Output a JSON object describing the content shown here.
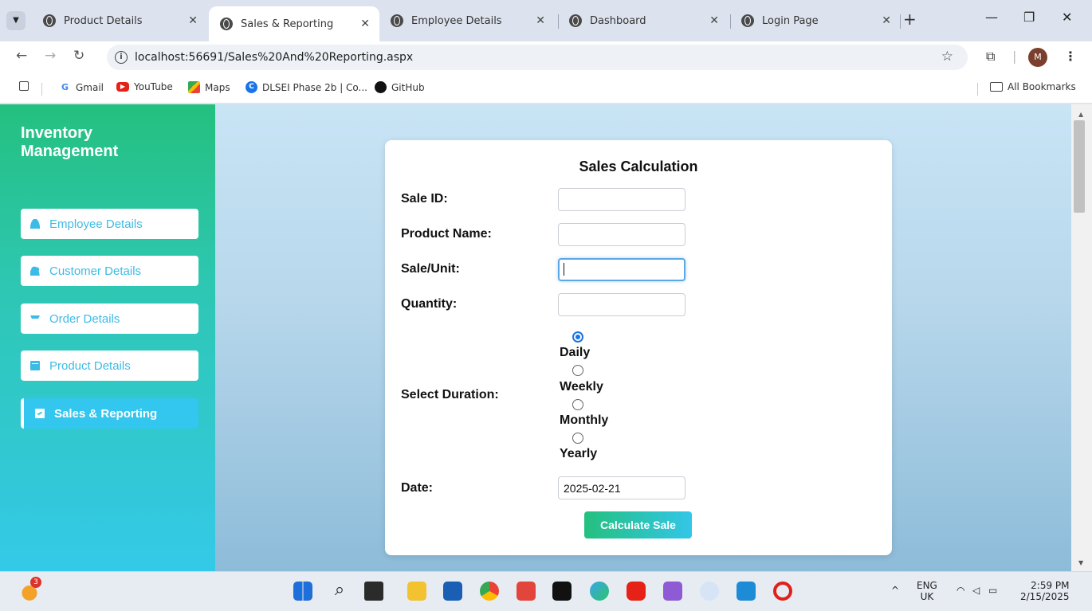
{
  "browser": {
    "tabs": [
      {
        "title": "Product Details",
        "active": false
      },
      {
        "title": "Sales & Reporting",
        "active": true
      },
      {
        "title": "Employee Details",
        "active": false
      },
      {
        "title": "Dashboard",
        "active": false
      },
      {
        "title": "Login Page",
        "active": false
      }
    ],
    "url": "localhost:56691/Sales%20And%20Reporting.aspx",
    "profile_initial": "M",
    "bookmarks": [
      {
        "label": "Gmail",
        "icon": "gmail-icon"
      },
      {
        "label": "YouTube",
        "icon": "youtube-icon"
      },
      {
        "label": "Maps",
        "icon": "maps-icon"
      },
      {
        "label": "DLSEI Phase 2b | Co...",
        "icon": "dlsei-icon"
      },
      {
        "label": "GitHub",
        "icon": "github-icon"
      }
    ],
    "all_bookmarks_label": "All Bookmarks"
  },
  "sidebar": {
    "brand": "Inventory Management",
    "items": [
      {
        "label": "Employee Details",
        "icon": "person-icon",
        "active": false
      },
      {
        "label": "Customer Details",
        "icon": "people-icon",
        "active": false
      },
      {
        "label": "Order Details",
        "icon": "cart-icon",
        "active": false
      },
      {
        "label": "Product Details",
        "icon": "archive-icon",
        "active": false
      },
      {
        "label": "Sales & Reporting",
        "icon": "chart-icon",
        "active": true
      }
    ]
  },
  "form": {
    "title": "Sales Calculation",
    "sale_id_label": "Sale ID:",
    "sale_id_value": "",
    "product_name_label": "Product Name:",
    "product_name_value": "",
    "sale_unit_label": "Sale/Unit:",
    "sale_unit_value": "",
    "quantity_label": "Quantity:",
    "quantity_value": "",
    "duration_label": "Select Duration:",
    "durations": [
      {
        "label": "Daily",
        "checked": true
      },
      {
        "label": "Weekly",
        "checked": false
      },
      {
        "label": "Monthly",
        "checked": false
      },
      {
        "label": "Yearly",
        "checked": false
      }
    ],
    "date_label": "Date:",
    "date_value": "2025-02-21",
    "submit_label": "Calculate Sale"
  },
  "taskbar": {
    "weather_badge": "3",
    "language": "ENG",
    "region": "UK",
    "time": "2:59 PM",
    "date": "2/15/2025"
  },
  "colors": {
    "sidebar_top": "#24c07f",
    "sidebar_bottom": "#34c9e8",
    "menu_text": "#3cbbe6",
    "active_item": "#33c6ef"
  }
}
